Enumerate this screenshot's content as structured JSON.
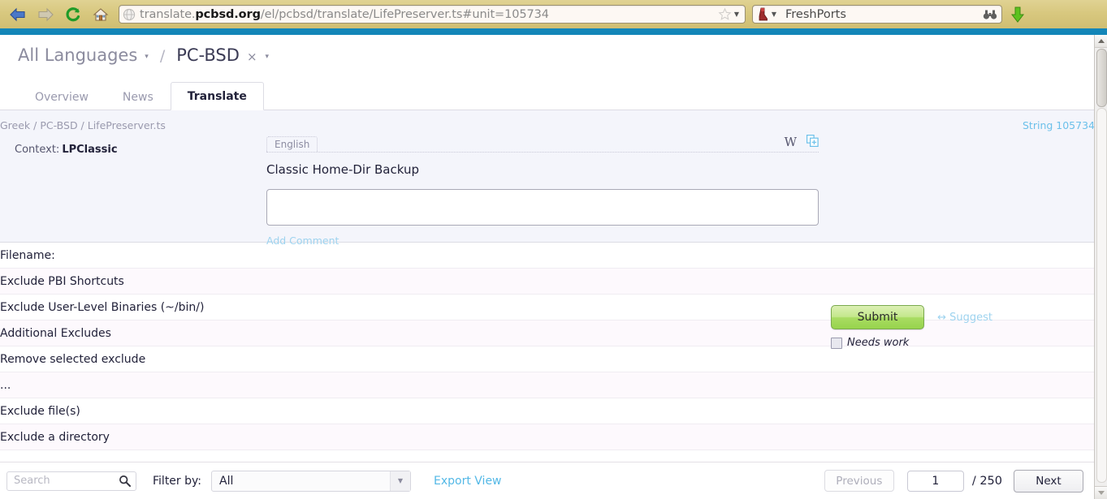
{
  "browser": {
    "back_icon": "back-arrow-icon",
    "forward_icon": "forward-arrow-icon",
    "reload_icon": "reload-icon",
    "home_icon": "home-icon",
    "url_prefix": "translate.",
    "url_domain": "pcbsd.org",
    "url_path": "/el/pcbsd/translate/LifePreserver.ts#unit=105734",
    "url_full": "translate.pcbsd.org/el/pcbsd/translate/LifePreserver.ts#unit=105734",
    "bookmark_icon": "star-icon",
    "url_dropdown_icon": "chevron-down-icon",
    "search_engine_icon": "freshports-icon",
    "search_placeholder": "FreshPorts",
    "search_value": "FreshPorts",
    "binoculars_icon": "binoculars-icon",
    "download_icon": "download-arrow-icon"
  },
  "header": {
    "all_languages": "All Languages",
    "separator": "/",
    "project": "PC-BSD",
    "close_label": "×",
    "caret": "▾",
    "tabs": [
      {
        "label": "Overview",
        "active": false
      },
      {
        "label": "News",
        "active": false
      },
      {
        "label": "Translate",
        "active": true
      }
    ]
  },
  "unit": {
    "breadcrumb": "Greek / PC-BSD / LifePreserver.ts",
    "string_id": "String 105734",
    "context_label": "Context:",
    "context_value": "LPClassic",
    "source_lang": "English",
    "source_text": "Classic Home-Dir Backup",
    "translation_value": "",
    "add_comment": "Add Comment",
    "wikipedia_icon": "W",
    "copy_icon": "copy-to-translation-icon",
    "submit_label": "Submit",
    "suggest_label": "↔ Suggest",
    "needs_work_label": "Needs work",
    "needs_work_checked": false
  },
  "rows": [
    "Filename:",
    "Exclude PBI Shortcuts",
    "Exclude User-Level Binaries (~/bin/)",
    "Additional Excludes",
    "Remove selected exclude",
    "...",
    "Exclude file(s)",
    "Exclude a directory"
  ],
  "footer": {
    "search_placeholder": "Search",
    "search_value": "",
    "search_icon": "search-icon",
    "filter_label": "Filter by:",
    "filter_value": "All",
    "filter_options": [
      "All"
    ],
    "export_label": "Export View",
    "previous_label": "Previous",
    "page_value": "1",
    "page_total": "/ 250",
    "next_label": "Next"
  },
  "colors": {
    "chrome": "#d8c87f",
    "band": "#1386b8",
    "link": "#53b8e6",
    "submit": "#a9dc63",
    "unit_bg": "#f4f5fb"
  }
}
